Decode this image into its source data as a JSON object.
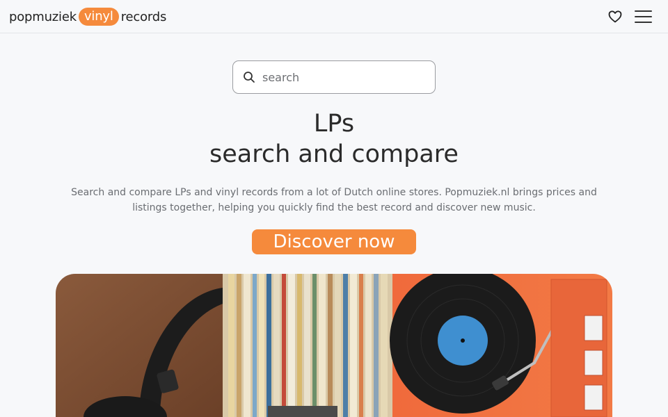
{
  "header": {
    "logo": {
      "part1": "popmuziek",
      "part2": "vinyl",
      "part3": "records"
    },
    "favorites_icon": "heart-icon",
    "menu_icon": "hamburger-menu-icon"
  },
  "search": {
    "placeholder": "search",
    "icon": "search-icon"
  },
  "hero": {
    "title_line1": "LPs",
    "title_line2": "search and compare",
    "description": "Search and compare LPs and vinyl records from a lot of Dutch online stores. Popmuziek.nl brings prices and listings together, helping you quickly find the best record and discover new music.",
    "cta_label": "Discover now"
  },
  "colors": {
    "accent": "#f58a3c",
    "background": "#f7f8fa",
    "turntable": "#f0673a"
  }
}
